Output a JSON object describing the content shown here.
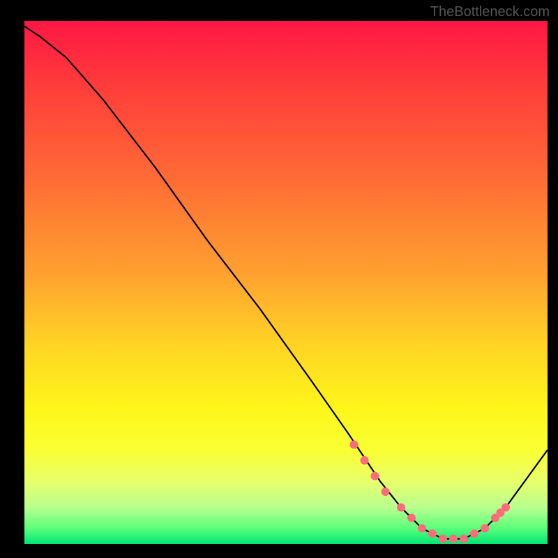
{
  "watermark": "TheBottleneck.com",
  "chart_data": {
    "type": "line",
    "title": "",
    "xlabel": "",
    "ylabel": "",
    "xlim": [
      0,
      100
    ],
    "ylim": [
      0,
      100
    ],
    "curve": {
      "x": [
        0,
        3,
        8,
        15,
        25,
        35,
        45,
        55,
        62,
        68,
        72,
        76,
        80,
        84,
        88,
        92,
        100
      ],
      "y": [
        99,
        97,
        93,
        85,
        72,
        58,
        45,
        31,
        21,
        12,
        7,
        3,
        1,
        1,
        3,
        7,
        18
      ]
    },
    "markers": {
      "x": [
        63,
        65,
        67,
        69,
        72,
        74,
        76,
        78,
        80,
        82,
        84,
        86,
        88,
        90,
        91,
        92
      ],
      "y": [
        19,
        16,
        13,
        10,
        7,
        5,
        3,
        2,
        1,
        1,
        1,
        2,
        3,
        5,
        6,
        7
      ]
    },
    "gradient_stops": [
      {
        "offset": 0.0,
        "color": "#ff1744"
      },
      {
        "offset": 0.12,
        "color": "#ff3b3b"
      },
      {
        "offset": 0.3,
        "color": "#ff6b35"
      },
      {
        "offset": 0.48,
        "color": "#ffa030"
      },
      {
        "offset": 0.62,
        "color": "#ffd424"
      },
      {
        "offset": 0.74,
        "color": "#fff61a"
      },
      {
        "offset": 0.82,
        "color": "#faff33"
      },
      {
        "offset": 0.88,
        "color": "#e8ff6b"
      },
      {
        "offset": 0.93,
        "color": "#b8ff8f"
      },
      {
        "offset": 0.97,
        "color": "#5aff7a"
      },
      {
        "offset": 1.0,
        "color": "#00e676"
      }
    ],
    "marker_color": "#ff6b7a"
  }
}
